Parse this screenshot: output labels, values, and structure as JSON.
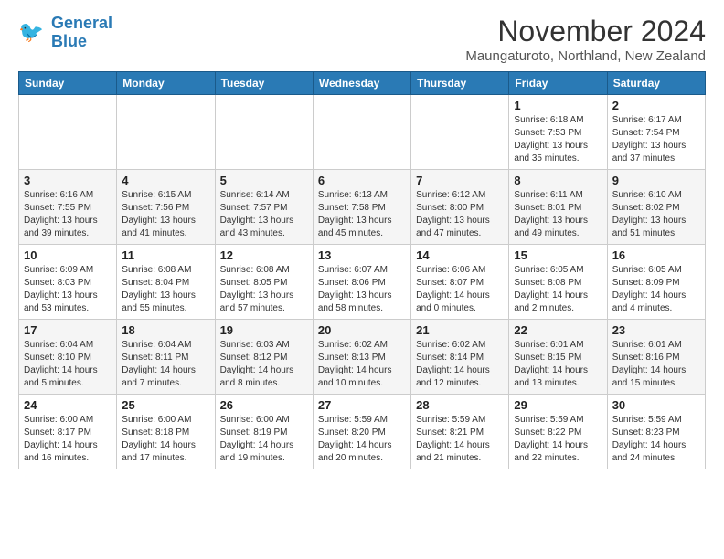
{
  "logo": {
    "line1": "General",
    "line2": "Blue"
  },
  "title": "November 2024",
  "subtitle": "Maungaturoto, Northland, New Zealand",
  "weekdays": [
    "Sunday",
    "Monday",
    "Tuesday",
    "Wednesday",
    "Thursday",
    "Friday",
    "Saturday"
  ],
  "weeks": [
    [
      {
        "day": "",
        "info": ""
      },
      {
        "day": "",
        "info": ""
      },
      {
        "day": "",
        "info": ""
      },
      {
        "day": "",
        "info": ""
      },
      {
        "day": "",
        "info": ""
      },
      {
        "day": "1",
        "info": "Sunrise: 6:18 AM\nSunset: 7:53 PM\nDaylight: 13 hours and 35 minutes."
      },
      {
        "day": "2",
        "info": "Sunrise: 6:17 AM\nSunset: 7:54 PM\nDaylight: 13 hours and 37 minutes."
      }
    ],
    [
      {
        "day": "3",
        "info": "Sunrise: 6:16 AM\nSunset: 7:55 PM\nDaylight: 13 hours and 39 minutes."
      },
      {
        "day": "4",
        "info": "Sunrise: 6:15 AM\nSunset: 7:56 PM\nDaylight: 13 hours and 41 minutes."
      },
      {
        "day": "5",
        "info": "Sunrise: 6:14 AM\nSunset: 7:57 PM\nDaylight: 13 hours and 43 minutes."
      },
      {
        "day": "6",
        "info": "Sunrise: 6:13 AM\nSunset: 7:58 PM\nDaylight: 13 hours and 45 minutes."
      },
      {
        "day": "7",
        "info": "Sunrise: 6:12 AM\nSunset: 8:00 PM\nDaylight: 13 hours and 47 minutes."
      },
      {
        "day": "8",
        "info": "Sunrise: 6:11 AM\nSunset: 8:01 PM\nDaylight: 13 hours and 49 minutes."
      },
      {
        "day": "9",
        "info": "Sunrise: 6:10 AM\nSunset: 8:02 PM\nDaylight: 13 hours and 51 minutes."
      }
    ],
    [
      {
        "day": "10",
        "info": "Sunrise: 6:09 AM\nSunset: 8:03 PM\nDaylight: 13 hours and 53 minutes."
      },
      {
        "day": "11",
        "info": "Sunrise: 6:08 AM\nSunset: 8:04 PM\nDaylight: 13 hours and 55 minutes."
      },
      {
        "day": "12",
        "info": "Sunrise: 6:08 AM\nSunset: 8:05 PM\nDaylight: 13 hours and 57 minutes."
      },
      {
        "day": "13",
        "info": "Sunrise: 6:07 AM\nSunset: 8:06 PM\nDaylight: 13 hours and 58 minutes."
      },
      {
        "day": "14",
        "info": "Sunrise: 6:06 AM\nSunset: 8:07 PM\nDaylight: 14 hours and 0 minutes."
      },
      {
        "day": "15",
        "info": "Sunrise: 6:05 AM\nSunset: 8:08 PM\nDaylight: 14 hours and 2 minutes."
      },
      {
        "day": "16",
        "info": "Sunrise: 6:05 AM\nSunset: 8:09 PM\nDaylight: 14 hours and 4 minutes."
      }
    ],
    [
      {
        "day": "17",
        "info": "Sunrise: 6:04 AM\nSunset: 8:10 PM\nDaylight: 14 hours and 5 minutes."
      },
      {
        "day": "18",
        "info": "Sunrise: 6:04 AM\nSunset: 8:11 PM\nDaylight: 14 hours and 7 minutes."
      },
      {
        "day": "19",
        "info": "Sunrise: 6:03 AM\nSunset: 8:12 PM\nDaylight: 14 hours and 8 minutes."
      },
      {
        "day": "20",
        "info": "Sunrise: 6:02 AM\nSunset: 8:13 PM\nDaylight: 14 hours and 10 minutes."
      },
      {
        "day": "21",
        "info": "Sunrise: 6:02 AM\nSunset: 8:14 PM\nDaylight: 14 hours and 12 minutes."
      },
      {
        "day": "22",
        "info": "Sunrise: 6:01 AM\nSunset: 8:15 PM\nDaylight: 14 hours and 13 minutes."
      },
      {
        "day": "23",
        "info": "Sunrise: 6:01 AM\nSunset: 8:16 PM\nDaylight: 14 hours and 15 minutes."
      }
    ],
    [
      {
        "day": "24",
        "info": "Sunrise: 6:00 AM\nSunset: 8:17 PM\nDaylight: 14 hours and 16 minutes."
      },
      {
        "day": "25",
        "info": "Sunrise: 6:00 AM\nSunset: 8:18 PM\nDaylight: 14 hours and 17 minutes."
      },
      {
        "day": "26",
        "info": "Sunrise: 6:00 AM\nSunset: 8:19 PM\nDaylight: 14 hours and 19 minutes."
      },
      {
        "day": "27",
        "info": "Sunrise: 5:59 AM\nSunset: 8:20 PM\nDaylight: 14 hours and 20 minutes."
      },
      {
        "day": "28",
        "info": "Sunrise: 5:59 AM\nSunset: 8:21 PM\nDaylight: 14 hours and 21 minutes."
      },
      {
        "day": "29",
        "info": "Sunrise: 5:59 AM\nSunset: 8:22 PM\nDaylight: 14 hours and 22 minutes."
      },
      {
        "day": "30",
        "info": "Sunrise: 5:59 AM\nSunset: 8:23 PM\nDaylight: 14 hours and 24 minutes."
      }
    ]
  ]
}
